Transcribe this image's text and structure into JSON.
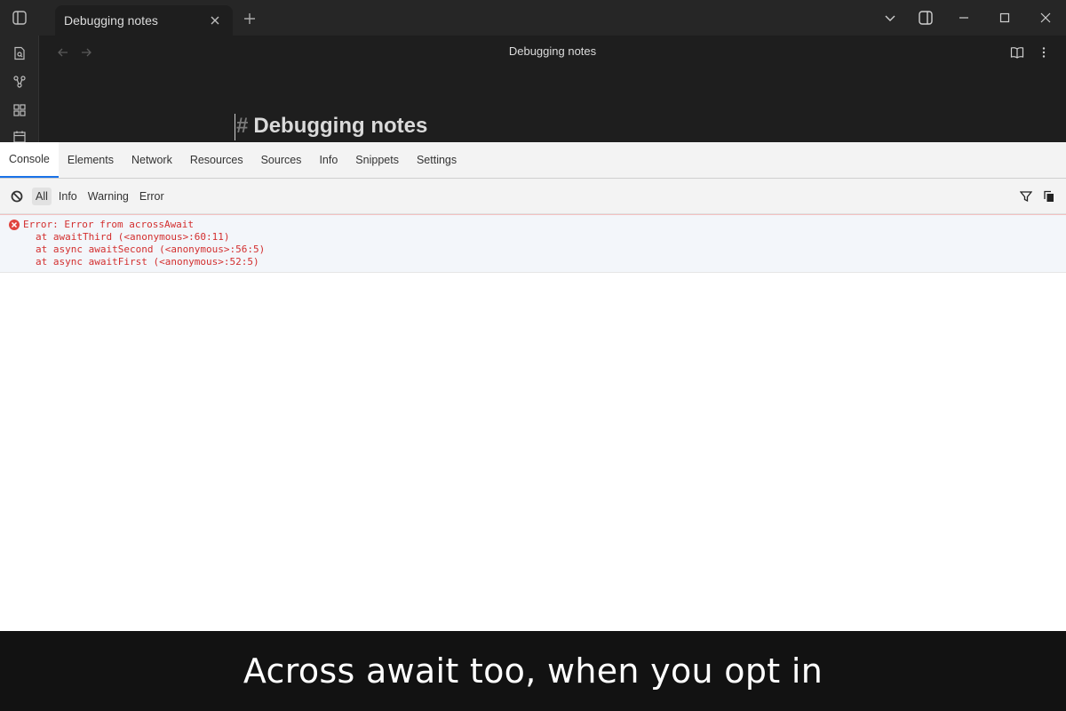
{
  "window": {
    "tab_title": "Debugging notes"
  },
  "editor": {
    "view_title": "Debugging notes",
    "heading_marker": "#",
    "heading_text": "Debugging notes"
  },
  "devtools": {
    "tabs": [
      "Console",
      "Elements",
      "Network",
      "Resources",
      "Sources",
      "Info",
      "Snippets",
      "Settings"
    ],
    "active_tab": "Console",
    "levels": [
      "All",
      "Info",
      "Warning",
      "Error"
    ],
    "active_level": "All",
    "error": {
      "message": "Error: Error from acrossAwait",
      "stack": [
        "at awaitThird (<anonymous>:60:11)",
        "at async awaitSecond (<anonymous>:56:5)",
        "at async awaitFirst (<anonymous>:52:5)"
      ]
    }
  },
  "caption": {
    "text": "Across await too, when you opt in"
  },
  "colors": {
    "error_red": "#d32f2f",
    "active_tab_accent": "#1a73e8"
  }
}
